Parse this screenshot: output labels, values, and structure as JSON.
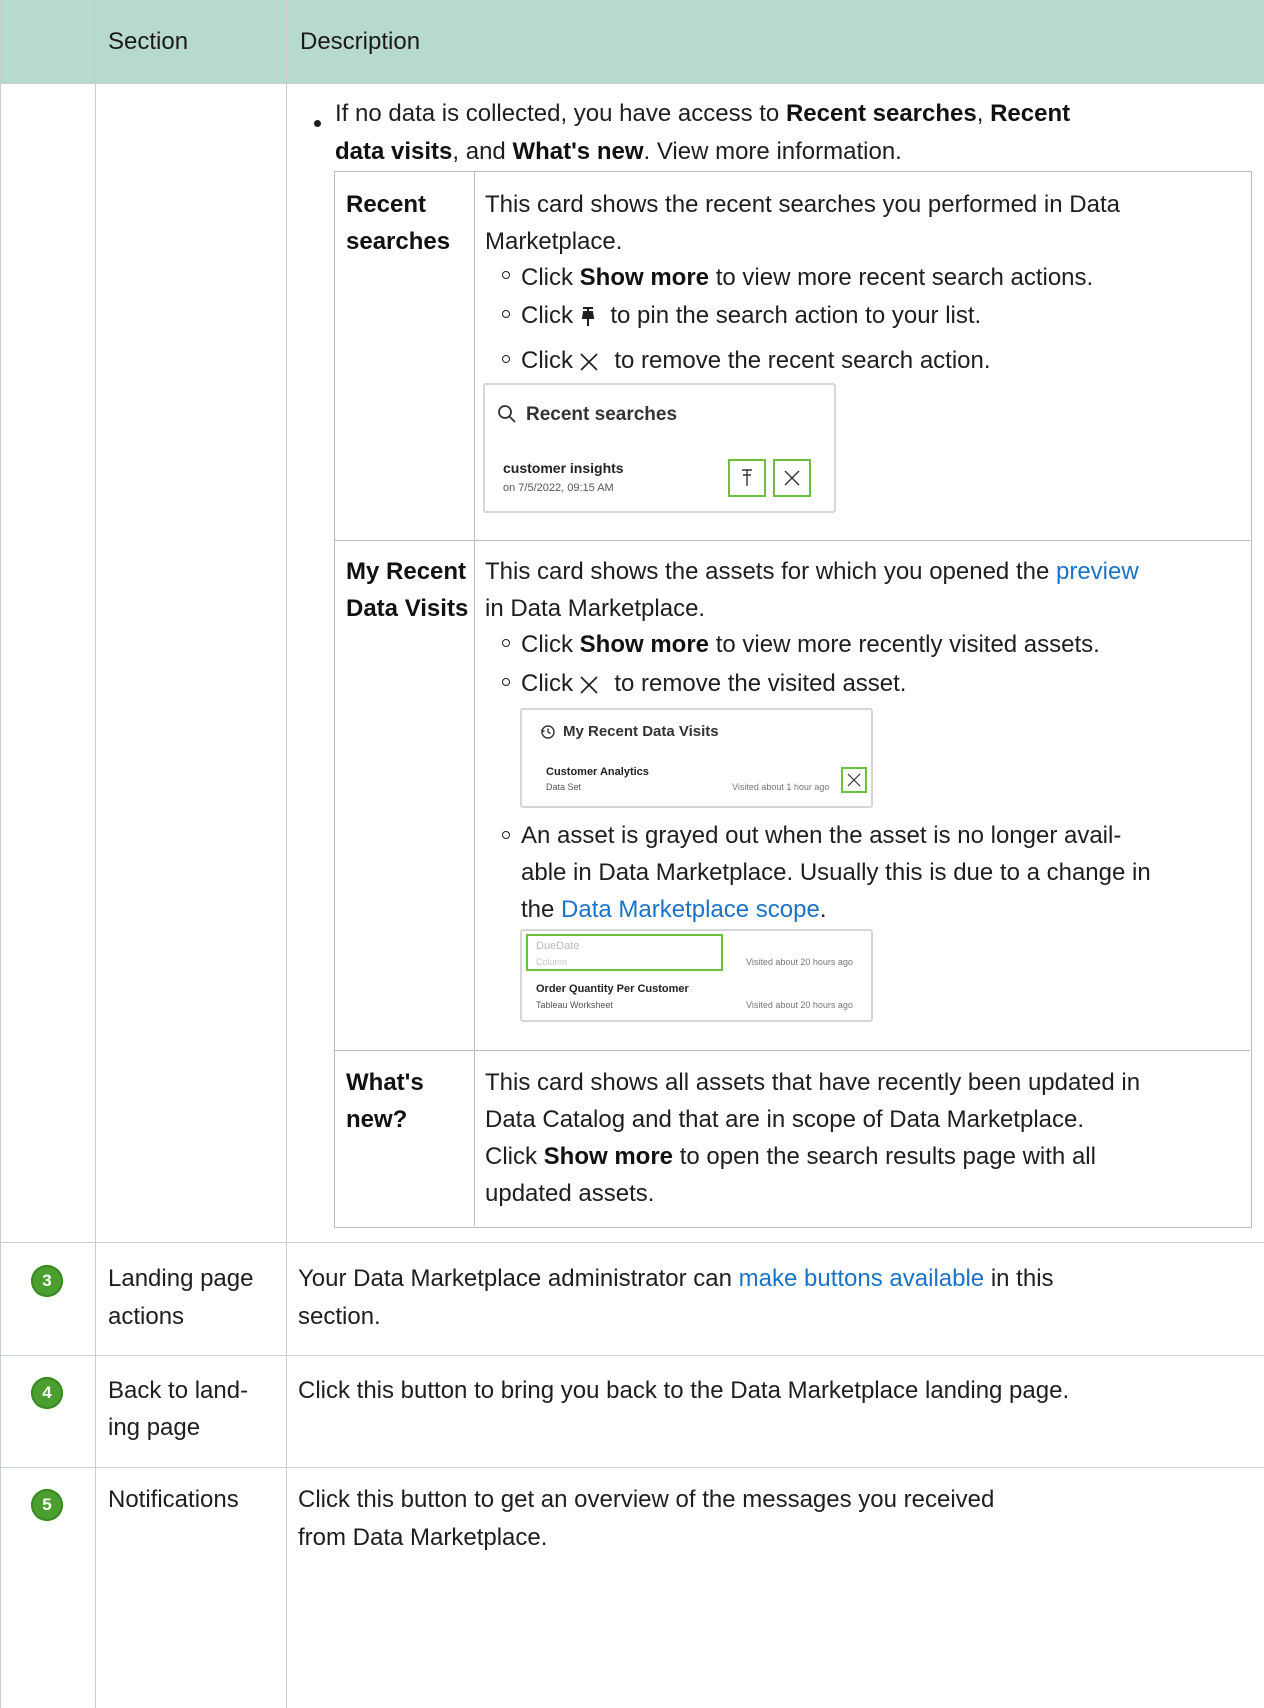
{
  "header": {
    "col_section": "Section",
    "col_description": "Description"
  },
  "intro": {
    "pre": "If no data is collected, you have access to ",
    "recent_searches": "Recent searches",
    "comma": ",",
    "recent_data_visits_1": "Recent",
    "recent_data_visits_2": "data visits",
    "and": ", and ",
    "whats_new": "What's new",
    "post": ". View more information."
  },
  "recent_searches": {
    "label_1": "Recent",
    "label_2": "searches",
    "desc_1": "This card shows the recent searches you performed in Data",
    "desc_2": "Marketplace.",
    "b1_pre": "Click ",
    "b1_bold": "Show more",
    "b1_post": " to view more recent search actions.",
    "b2_pre": "Click ",
    "b2_post": " to pin the search action to your list.",
    "b3_pre": "Click ",
    "b3_post": " to remove the recent search action.",
    "card_title": "Recent searches",
    "card_item": "customer insights",
    "card_date": "on 7/5/2022, 09:15 AM"
  },
  "recent_visits": {
    "label_1": "My Recent",
    "label_2": "Data Visits",
    "desc_pre": "This card shows the assets for which you opened the ",
    "desc_link": "preview",
    "desc_2": "in Data Marketplace.",
    "b1_pre": "Click ",
    "b1_bold": "Show more",
    "b1_post": " to view more recently visited assets.",
    "b2_pre": "Click ",
    "b2_post": " to remove the visited asset.",
    "card_title": "My Recent Data Visits",
    "card_item": "Customer Analytics",
    "card_type": "Data Set",
    "card_visited": "Visited about 1 hour ago",
    "b3_line1": "An asset is grayed out when the asset is no longer avail-",
    "b3_line2": "able in Data Marketplace. Usually this is due to a change in",
    "b3_pre3": "the ",
    "b3_link": "Data Marketplace scope",
    "b3_post3": ".",
    "card2_item1": "DueDate",
    "card2_type1": "Column",
    "card2_visited1": "Visited about 20 hours ago",
    "card2_item2": "Order Quantity Per Customer",
    "card2_type2": "Tableau Worksheet",
    "card2_visited2": "Visited about 20 hours ago"
  },
  "whats_new": {
    "label_1": "What's",
    "label_2": "new?",
    "line_1": "This card shows all assets that have recently been updated in",
    "line_2": "Data Catalog and that are in scope of Data Marketplace.",
    "line_3_pre": "Click ",
    "line_3_bold": "Show more",
    "line_3_post": " to open the search results page with all",
    "line_4": "updated assets."
  },
  "rows": [
    {
      "badge": "3",
      "section_1": "Landing page",
      "section_2": "actions",
      "desc_pre": "Your Data Marketplace administrator can ",
      "desc_link": "make buttons available",
      "desc_post": " in this",
      "desc_2": "section."
    },
    {
      "badge": "4",
      "section_1": "Back to land-",
      "section_2": "ing page",
      "desc_1": "Click this button to bring you back to the Data Marketplace landing page."
    },
    {
      "badge": "5",
      "section_1": "Notifications",
      "desc_1": "Click this button to get an overview of the messages you received",
      "desc_2": "from Data Marketplace."
    }
  ],
  "colors": {
    "header_bg": "#b8d9cd",
    "badge": "#4a9f2f",
    "link": "#1a73c7",
    "highlight": "#6cc03b"
  }
}
